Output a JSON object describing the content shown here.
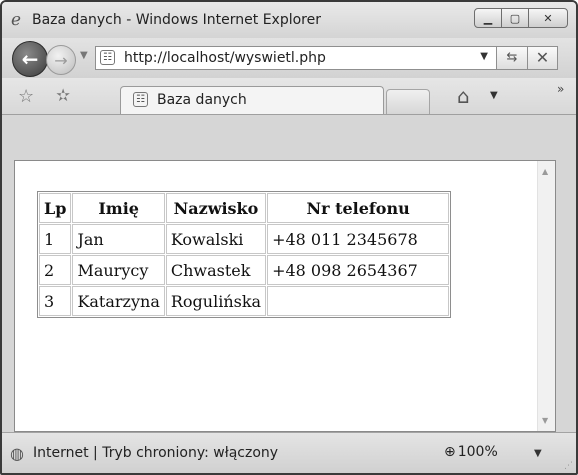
{
  "window": {
    "title": "Baza danych - Windows Internet Explorer"
  },
  "address": {
    "url": "http://localhost/wyswietl.php"
  },
  "tab": {
    "title": "Baza danych"
  },
  "table": {
    "headers": [
      "Lp",
      "Imię",
      "Nazwisko",
      "Nr telefonu"
    ],
    "rows": [
      [
        "1",
        "Jan",
        "Kowalski",
        "+48 011 2345678"
      ],
      [
        "2",
        "Maurycy",
        "Chwastek",
        "+48 098 2654367"
      ],
      [
        "3",
        "Katarzyna",
        "Rogulińska",
        ""
      ]
    ]
  },
  "status": {
    "text": "Internet | Tryb chroniony: włączony",
    "zoom": "100%"
  },
  "icons": {
    "title": "ie-logo-icon",
    "back": "back-arrow-icon",
    "forward": "forward-arrow-icon",
    "page": "page-icon",
    "refresh": "refresh-icon",
    "stop": "stop-icon",
    "favorites": "star-icon",
    "add_favorites": "add-favorites-icon",
    "home": "home-icon",
    "globe": "globe-icon",
    "zoom": "zoom-icon"
  }
}
